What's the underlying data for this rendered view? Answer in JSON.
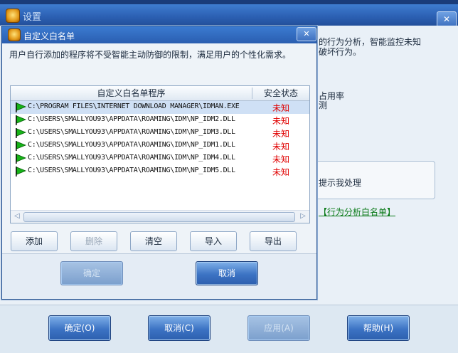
{
  "parent": {
    "title": "设置",
    "close": "✕",
    "text_line1": "的行为分析，智能监控未知",
    "text_line2": "破坏行为。",
    "text_line3": "占用率",
    "text_line4": "测",
    "frame_text": "提示我处理",
    "link_text": "【行为分析白名单】",
    "buttons": {
      "ok": "确定(O)",
      "cancel": "取消(C)",
      "apply": "应用(A)",
      "help": "帮助(H)"
    }
  },
  "dialog": {
    "title": "自定义白名单",
    "close": "✕",
    "description": "用户自行添加的程序将不受智能主动防御的限制，满足用户的个性化需求。",
    "columns": {
      "program": "自定义白名单程序",
      "status": "安全状态"
    },
    "rows": [
      {
        "path": "C:\\PROGRAM FILES\\INTERNET DOWNLOAD MANAGER\\IDMAN.EXE",
        "status": "未知",
        "selected": true
      },
      {
        "path": "C:\\USERS\\SMALLYOU93\\APPDATA\\ROAMING\\IDM\\NP_IDM2.DLL",
        "status": "未知",
        "selected": false
      },
      {
        "path": "C:\\USERS\\SMALLYOU93\\APPDATA\\ROAMING\\IDM\\NP_IDM3.DLL",
        "status": "未知",
        "selected": false
      },
      {
        "path": "C:\\USERS\\SMALLYOU93\\APPDATA\\ROAMING\\IDM\\NP_IDM1.DLL",
        "status": "未知",
        "selected": false
      },
      {
        "path": "C:\\USERS\\SMALLYOU93\\APPDATA\\ROAMING\\IDM\\NP_IDM4.DLL",
        "status": "未知",
        "selected": false
      },
      {
        "path": "C:\\USERS\\SMALLYOU93\\APPDATA\\ROAMING\\IDM\\NP_IDM5.DLL",
        "status": "未知",
        "selected": false
      }
    ],
    "buttons": {
      "add": "添加",
      "delete": "删除",
      "clear": "清空",
      "import": "导入",
      "export": "导出",
      "ok": "确定",
      "cancel": "取消"
    }
  }
}
